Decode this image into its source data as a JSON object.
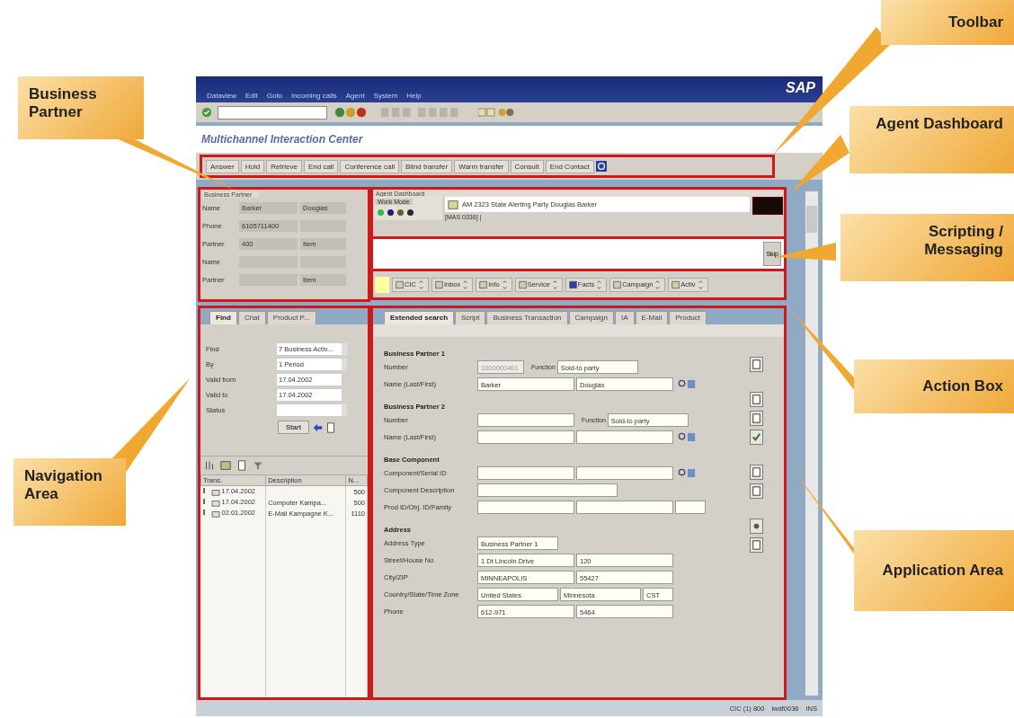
{
  "window": {
    "menu": [
      "Dataview",
      "Edit",
      "Goto",
      "Incoming calls",
      "Agent",
      "System",
      "Help"
    ],
    "logo": "SAP",
    "app_title": "Multichannel Interaction Center"
  },
  "cic_toolbar": [
    "Answer",
    "Hold",
    "Retrieve",
    "End call",
    "Conference call",
    "Blind transfer",
    "Warm transfer",
    "Consult",
    "End Contact"
  ],
  "business_partner": {
    "title": "Business Partner",
    "rows": [
      {
        "label": "Name",
        "first": "Barker",
        "second": "Douglas"
      },
      {
        "label": "Phone",
        "first": "6105711400"
      },
      {
        "label": "Partner",
        "first": "400",
        "second": "Item"
      },
      {
        "label": "Name"
      },
      {
        "label": "Partner",
        "second": "Item"
      }
    ]
  },
  "agent_dashboard": {
    "title": "Agent Dashboard",
    "work_mode": "Work Mode",
    "lights": [
      {
        "color": "#33bb33"
      },
      {
        "color": "#1a1a80"
      },
      {
        "color": "#6b5a2a"
      },
      {
        "color": "#2a2a2a"
      }
    ],
    "message": "AM 2323 State Alerting Party Douglas Barker",
    "sub_message": "[MAS 0336] |"
  },
  "scripting": {
    "button": "Skip"
  },
  "action_box": [
    "CIC",
    "Inbox",
    "Info",
    "Service",
    "Facts",
    "Campaign",
    "Activ"
  ],
  "navigation": {
    "tabs": [
      {
        "label": "Find",
        "selected": true
      },
      {
        "label": "Chat",
        "selected": false
      },
      {
        "label": "Product P...",
        "selected": false
      }
    ],
    "fields": [
      {
        "label": "Find",
        "value": "7 Business Activ...",
        "kind": "select"
      },
      {
        "label": "By",
        "value": "1 Period",
        "kind": "select"
      },
      {
        "label": "Valid from",
        "value": "17.04.2002",
        "kind": "text"
      },
      {
        "label": "Valid to",
        "value": "17.04.2002",
        "kind": "text"
      },
      {
        "label": "Status",
        "kind": "select"
      }
    ],
    "start_button": "Start",
    "table": {
      "columns": [
        "Trans.",
        "Description",
        "N..."
      ],
      "rows": [
        [
          "17.04.2002",
          "",
          "500"
        ],
        [
          "17.04.2002",
          "Computer Kampa...",
          "500"
        ],
        [
          "02.01.2002",
          "E-Mail Kampagne K...",
          "1110"
        ]
      ]
    }
  },
  "application": {
    "tabs": [
      {
        "label": "Extended search",
        "selected": true
      },
      {
        "label": "Script",
        "selected": false
      },
      {
        "label": "Business Transaction",
        "selected": false
      },
      {
        "label": "Campaign",
        "selected": false
      },
      {
        "label": "IA",
        "selected": false
      },
      {
        "label": "E-Mail",
        "selected": false
      },
      {
        "label": "Product",
        "selected": false
      }
    ],
    "sections": [
      {
        "title": "Business Partner 1",
        "rows": [
          {
            "label": "Number",
            "fields": [
              {
                "value": "1000000401",
                "kind": "disabled"
              },
              {
                "value": "Sold-to party",
                "kind": "select",
                "caption": "Function"
              }
            ]
          },
          {
            "label": "Name (Last/First)",
            "fields": [
              {
                "value": "Barker",
                "kind": "text"
              },
              {
                "value": "Douglas",
                "kind": "text"
              }
            ],
            "search": true
          }
        ]
      },
      {
        "title": "Business Partner 2",
        "rows": [
          {
            "label": "Number",
            "fields": [
              {
                "kind": "text"
              },
              {
                "value": "Sold-to party",
                "kind": "select",
                "caption": "Function"
              }
            ]
          },
          {
            "label": "Name (Last/First)",
            "fields": [
              {
                "kind": "text"
              },
              {
                "kind": "text"
              }
            ],
            "search": true
          }
        ]
      },
      {
        "title": "Base Component",
        "rows": [
          {
            "label": "Component/Serial ID",
            "fields": [
              {
                "kind": "text"
              },
              {
                "kind": "text"
              }
            ],
            "search": true
          },
          {
            "label": "Component Description",
            "fields": [
              {
                "kind": "text"
              }
            ]
          },
          {
            "label": "Prod ID/Obj. ID/Family",
            "fields": [
              {
                "kind": "text"
              },
              {
                "kind": "text"
              },
              {
                "kind": "text"
              }
            ]
          }
        ]
      },
      {
        "title": "Address",
        "rows": [
          {
            "label": "Address Type",
            "fields": [
              {
                "value": "Business Partner 1",
                "kind": "select"
              }
            ]
          },
          {
            "label": "Street/House No",
            "fields": [
              {
                "value": "1 Dt Lincoln Drive",
                "kind": "text"
              },
              {
                "value": "120",
                "kind": "text"
              }
            ]
          },
          {
            "label": "City/ZIP",
            "fields": [
              {
                "value": "MINNEAPOLIS",
                "kind": "text"
              },
              {
                "value": "55427",
                "kind": "text"
              }
            ]
          },
          {
            "label": "Country/State/Time Zone",
            "fields": [
              {
                "value": "United States",
                "kind": "select"
              },
              {
                "value": "Minnesota",
                "kind": "select"
              },
              {
                "value": "CST",
                "kind": "text"
              }
            ]
          },
          {
            "label": "Phone",
            "fields": [
              {
                "value": "612-971",
                "kind": "text"
              },
              {
                "value": "5464",
                "kind": "text"
              }
            ]
          }
        ]
      }
    ]
  },
  "status_bar": [
    "CIC (1) 800",
    "iwdf0036",
    "INS"
  ],
  "callouts": [
    "Toolbar",
    "Business Partner",
    "Agent Dashboard",
    "Scripting / Messaging",
    "Action Box",
    "Navigation Area",
    "Application Area"
  ]
}
